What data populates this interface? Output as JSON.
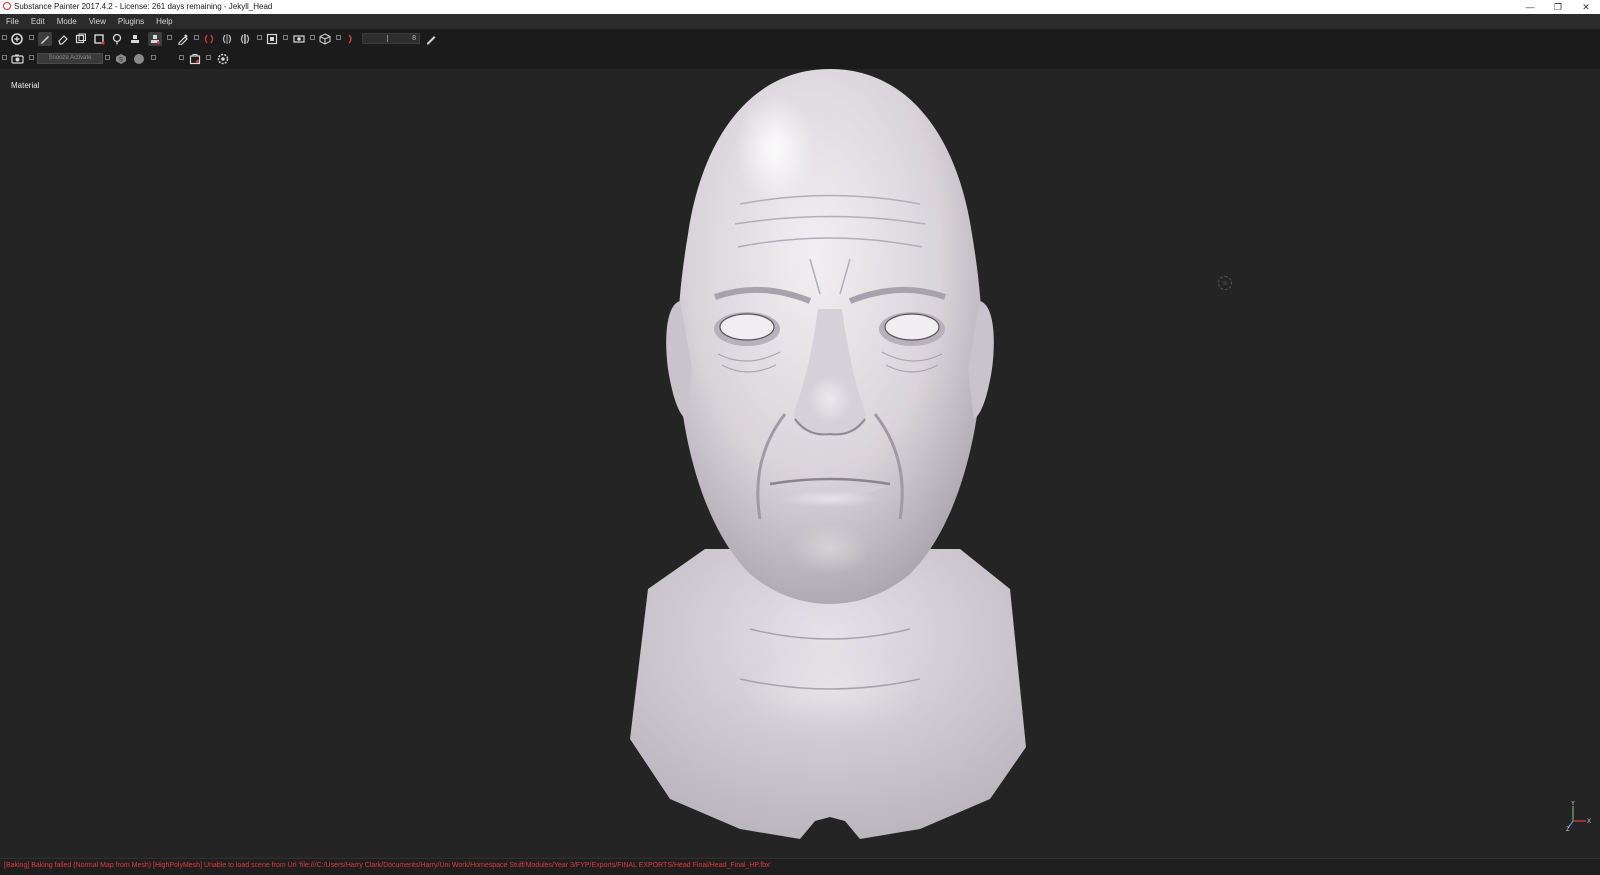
{
  "window": {
    "title": "Substance Painter 2017.4.2 - License: 261 days remaining - Jekyll_Head",
    "minimize": "—",
    "restore": "❐",
    "close": "✕"
  },
  "menu": [
    "File",
    "Edit",
    "Mode",
    "View",
    "Plugins",
    "Help"
  ],
  "toolbar": {
    "row1_tools": [
      "substance-logo-icon",
      "paint-brush-icon",
      "eraser-icon",
      "projection-icon",
      "polygon-fill-icon",
      "smudge-icon",
      "clone-icon",
      "material-picker-icon",
      "color-picker-icon",
      "symmetry-icon",
      "symmetry-mirror-icon",
      "symmetry-settings-icon",
      "camera-view-icon",
      "render-icon",
      "cube-icon",
      "lazy-mouse-icon"
    ],
    "brush_value": "8",
    "row2_tools": [
      "camera-icon",
      "screenshot-icon",
      "substance-share-icon",
      "sphere-icon",
      "photoshop-icon",
      "export-icon",
      "settings-gear-icon"
    ],
    "tooltip": "Snooze Activate",
    "ps_label": "Ps"
  },
  "viewport": {
    "mode_label": "Material",
    "axis_labels": {
      "x": "X",
      "y": "Y",
      "z": "Z"
    },
    "axis_colors": {
      "x": "#d43c3c",
      "y": "#58b858",
      "z": "#5a8ad6"
    }
  },
  "status": {
    "message": "[Baking] Baking failed (Normal Map from Mesh) [HighPolyMesh] Unable to load scene from Url 'file:///C:/Users/Harry Clark/Documents/Harry/Uni Work/Homespace Stuff/Modules/Year 3/FYP/Exports/FINAL EXPORTS/Head Final/Head_Final_HP.fbx'",
    "message_color": "#e03a3a"
  }
}
